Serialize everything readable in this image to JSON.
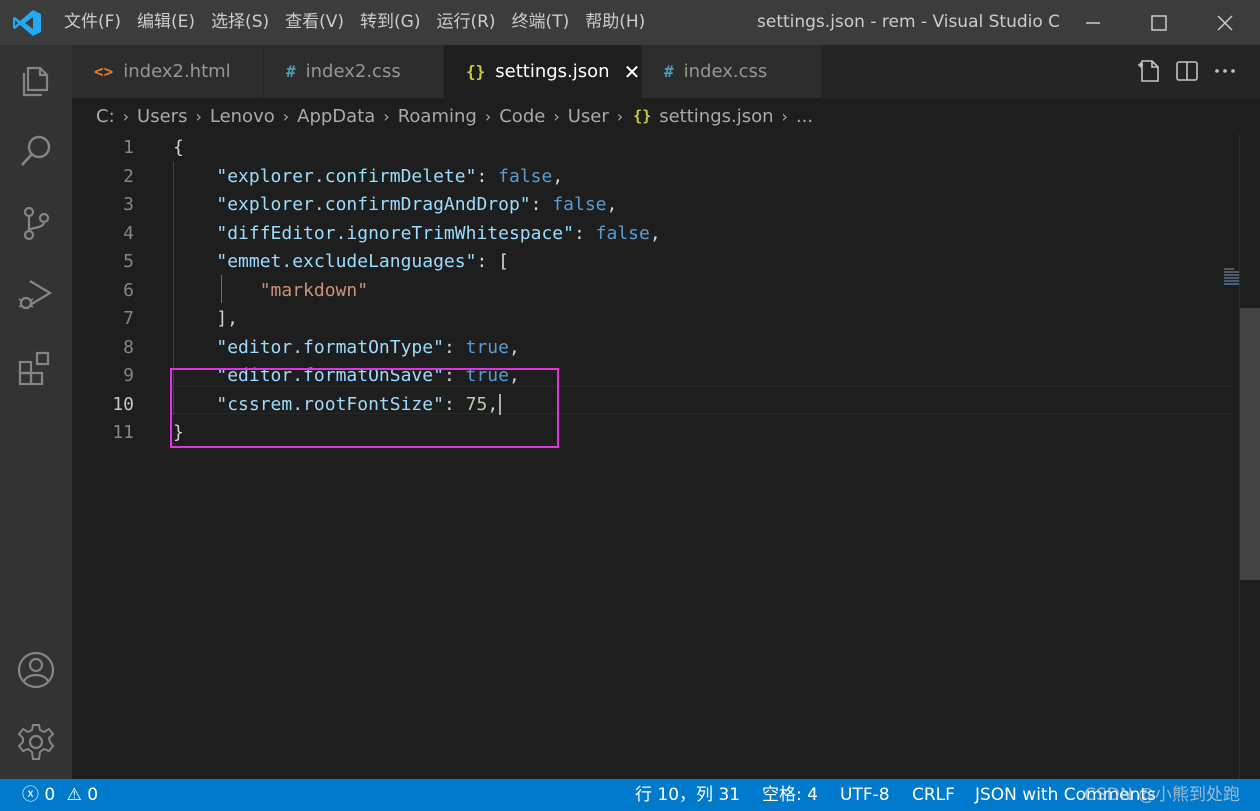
{
  "titlebar": {
    "menu": [
      "文件(F)",
      "编辑(E)",
      "选择(S)",
      "查看(V)",
      "转到(G)",
      "运行(R)",
      "终端(T)",
      "帮助(H)"
    ],
    "window_title": "settings.json - rem - Visual Studio C..."
  },
  "tabs": [
    {
      "label": "index2.html",
      "icon": "<>",
      "icon_color": "#e37933"
    },
    {
      "label": "index2.css",
      "icon": "#",
      "icon_color": "#519aba"
    },
    {
      "label": "settings.json",
      "icon": "{}",
      "icon_color": "#cbcb41",
      "active": true,
      "close": "✕"
    },
    {
      "label": "index.css",
      "icon": "#",
      "icon_color": "#519aba"
    }
  ],
  "breadcrumb": [
    "C:",
    "Users",
    "Lenovo",
    "AppData",
    "Roaming",
    "Code",
    "User",
    "settings.json",
    "..."
  ],
  "editor": {
    "line_numbers": [
      "1",
      "2",
      "3",
      "4",
      "5",
      "6",
      "7",
      "8",
      "9",
      "10",
      "11"
    ],
    "current_line": "10",
    "lines": [
      [
        [
          "p",
          "{"
        ]
      ],
      [
        [
          "p",
          "    "
        ],
        [
          "k",
          "\"explorer.confirmDelete\""
        ],
        [
          "p",
          ": "
        ],
        [
          "b",
          "false"
        ],
        [
          "p",
          ","
        ]
      ],
      [
        [
          "p",
          "    "
        ],
        [
          "k",
          "\"explorer.confirmDragAndDrop\""
        ],
        [
          "p",
          ": "
        ],
        [
          "b",
          "false"
        ],
        [
          "p",
          ","
        ]
      ],
      [
        [
          "p",
          "    "
        ],
        [
          "k",
          "\"diffEditor.ignoreTrimWhitespace\""
        ],
        [
          "p",
          ": "
        ],
        [
          "b",
          "false"
        ],
        [
          "p",
          ","
        ]
      ],
      [
        [
          "p",
          "    "
        ],
        [
          "k",
          "\"emmet.excludeLanguages\""
        ],
        [
          "p",
          ": ["
        ]
      ],
      [
        [
          "p",
          "        "
        ],
        [
          "s",
          "\"markdown\""
        ]
      ],
      [
        [
          "p",
          "    ],"
        ]
      ],
      [
        [
          "p",
          "    "
        ],
        [
          "k",
          "\"editor.formatOnType\""
        ],
        [
          "p",
          ": "
        ],
        [
          "b",
          "true"
        ],
        [
          "p",
          ","
        ]
      ],
      [
        [
          "p",
          "    "
        ],
        [
          "k",
          "\"editor.formatOnSave\""
        ],
        [
          "p",
          ": "
        ],
        [
          "b",
          "true"
        ],
        [
          "p",
          ","
        ]
      ],
      [
        [
          "p",
          "    "
        ],
        [
          "k",
          "\"cssrem.rootFontSize\""
        ],
        [
          "p",
          ": "
        ],
        [
          "n",
          "75"
        ],
        [
          "p",
          ","
        ]
      ],
      [
        [
          "p",
          "}"
        ]
      ]
    ]
  },
  "statusbar": {
    "errors": "0",
    "warnings": "0",
    "position": "行 10，列 31",
    "indent": "空格: 4",
    "encoding": "UTF-8",
    "eol": "CRLF",
    "language": "JSON with Comments",
    "watermark": "CSDN @小熊到处跑"
  },
  "colors": {
    "accent": "#007acc",
    "highlight_box": "#e233e2"
  }
}
